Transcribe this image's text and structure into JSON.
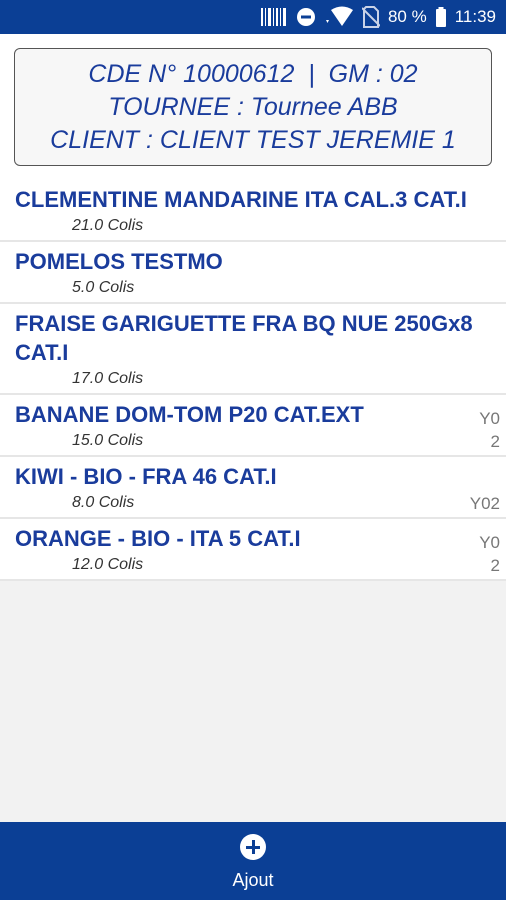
{
  "status_bar": {
    "battery": "80 %",
    "time": "11:39",
    "icons": [
      "barcode-icon",
      "do-not-disturb-icon",
      "wifi-icon",
      "no-sim-icon",
      "battery-icon"
    ]
  },
  "order": {
    "line1": "CDE N° 10000612  |  GM : 02",
    "line2": "TOURNEE : Tournee ABB",
    "line3": "CLIENT : CLIENT TEST JEREMIE 1"
  },
  "items": [
    {
      "name": "CLEMENTINE MANDARINE ITA CAL.3 CAT.I",
      "quantity": "21.0 Colis",
      "code": ""
    },
    {
      "name": "POMELOS TESTMO",
      "quantity": "5.0 Colis",
      "code": ""
    },
    {
      "name": "FRAISE GARIGUETTE FRA BQ NUE 250Gx8 CAT.I",
      "quantity": "17.0 Colis",
      "code": ""
    },
    {
      "name": "BANANE DOM-TOM P20 CAT.EXT",
      "quantity": "15.0 Colis",
      "code": "Y0\n2"
    },
    {
      "name": "KIWI - BIO - FRA 46 CAT.I",
      "quantity": "8.0 Colis",
      "code": "Y02"
    },
    {
      "name": "ORANGE - BIO - ITA 5 CAT.I",
      "quantity": "12.0 Colis",
      "code": "Y0\n2"
    }
  ],
  "bottom_bar": {
    "add_label": "Ajout"
  },
  "colors": {
    "primary": "#0b3f95",
    "text_blue": "#1a3c9c"
  }
}
